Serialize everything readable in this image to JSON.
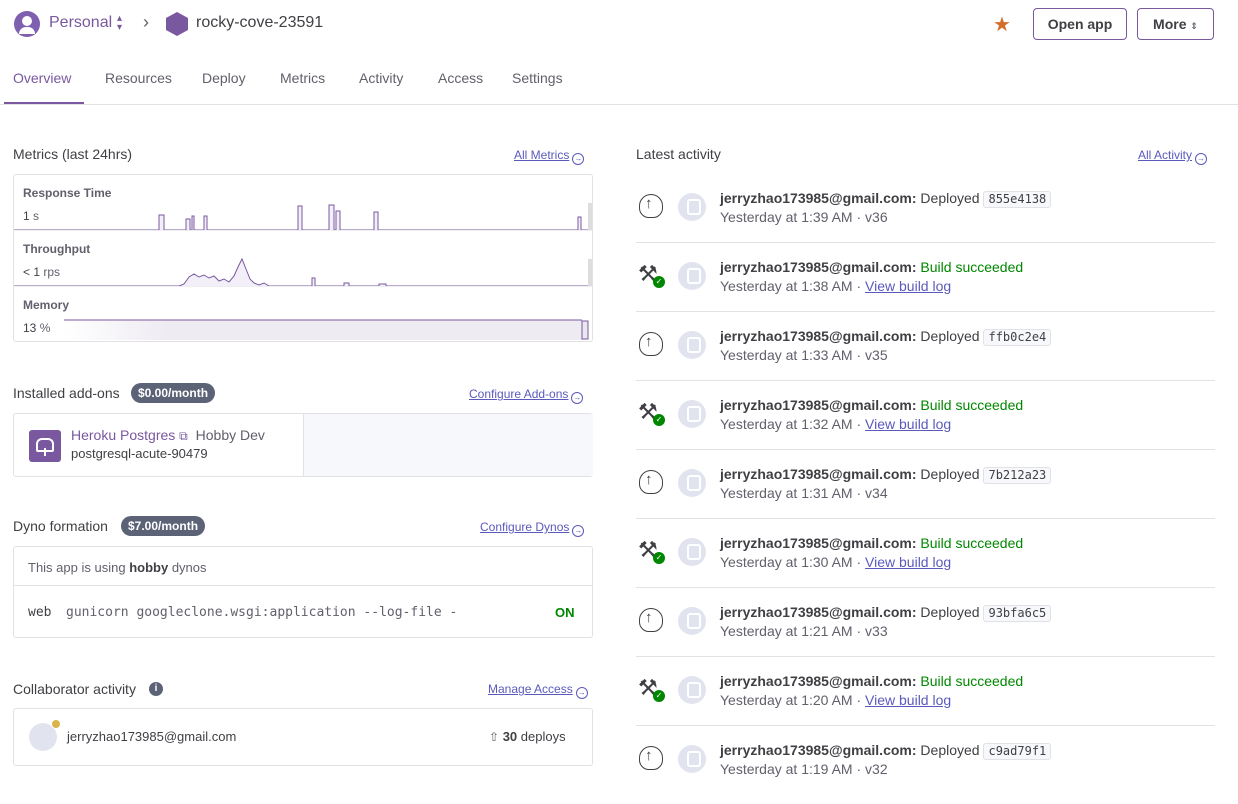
{
  "header": {
    "team": "Personal",
    "app": "rocky-cove-23591",
    "open_app": "Open app",
    "more": "More"
  },
  "tabs": [
    {
      "label": "Overview",
      "active": true
    },
    {
      "label": "Resources"
    },
    {
      "label": "Deploy"
    },
    {
      "label": "Metrics"
    },
    {
      "label": "Activity"
    },
    {
      "label": "Access"
    },
    {
      "label": "Settings"
    }
  ],
  "metrics": {
    "title": "Metrics (last 24hrs)",
    "link": "All Metrics",
    "response_time": {
      "label": "Response Time",
      "value": "1",
      "unit": "s"
    },
    "throughput": {
      "label": "Throughput",
      "value": "< 1",
      "unit": "rps"
    },
    "memory": {
      "label": "Memory",
      "value": "13",
      "unit": "%"
    }
  },
  "addons": {
    "title": "Installed add-ons",
    "price": "$0.00/month",
    "link": "Configure Add-ons",
    "items": [
      {
        "name": "Heroku Postgres",
        "plan": "Hobby Dev",
        "resource": "postgresql-acute-90479"
      }
    ]
  },
  "dynos": {
    "title": "Dyno formation",
    "price": "$7.00/month",
    "link": "Configure Dynos",
    "note_prefix": "This app is using",
    "note_type": "hobby",
    "note_suffix": "dynos",
    "process": {
      "type": "web",
      "command": "gunicorn googleclone.wsgi:application --log-file -",
      "state": "ON"
    }
  },
  "collaborators": {
    "title": "Collaborator activity",
    "link": "Manage Access",
    "items": [
      {
        "email": "jerryzhao173985@gmail.com",
        "deploys": "30",
        "deploys_label": "deploys"
      }
    ]
  },
  "activity": {
    "title": "Latest activity",
    "link": "All Activity",
    "items": [
      {
        "kind": "deploy",
        "user": "jerryzhao173985@gmail.com:",
        "action": "Deployed",
        "sha": "855e4138",
        "time": "Yesterday at 1:39 AM",
        "version": "v36"
      },
      {
        "kind": "build",
        "user": "jerryzhao173985@gmail.com:",
        "action": "Build succeeded",
        "time": "Yesterday at 1:38 AM",
        "log": "View build log"
      },
      {
        "kind": "deploy",
        "user": "jerryzhao173985@gmail.com:",
        "action": "Deployed",
        "sha": "ffb0c2e4",
        "time": "Yesterday at 1:33 AM",
        "version": "v35"
      },
      {
        "kind": "build",
        "user": "jerryzhao173985@gmail.com:",
        "action": "Build succeeded",
        "time": "Yesterday at 1:32 AM",
        "log": "View build log"
      },
      {
        "kind": "deploy",
        "user": "jerryzhao173985@gmail.com:",
        "action": "Deployed",
        "sha": "7b212a23",
        "time": "Yesterday at 1:31 AM",
        "version": "v34"
      },
      {
        "kind": "build",
        "user": "jerryzhao173985@gmail.com:",
        "action": "Build succeeded",
        "time": "Yesterday at 1:30 AM",
        "log": "View build log"
      },
      {
        "kind": "deploy",
        "user": "jerryzhao173985@gmail.com:",
        "action": "Deployed",
        "sha": "93bfa6c5",
        "time": "Yesterday at 1:21 AM",
        "version": "v33"
      },
      {
        "kind": "build",
        "user": "jerryzhao173985@gmail.com:",
        "action": "Build succeeded",
        "time": "Yesterday at 1:20 AM",
        "log": "View build log"
      },
      {
        "kind": "deploy",
        "user": "jerryzhao173985@gmail.com:",
        "action": "Deployed",
        "sha": "c9ad79f1",
        "time": "Yesterday at 1:19 AM",
        "version": "v32"
      }
    ]
  },
  "colors": {
    "brand": "#79589f",
    "link": "#5b59bc",
    "success": "#008700",
    "star": "#d36d29"
  },
  "icons": [
    "user-avatar-icon",
    "chevron-updown-icon",
    "chevron-right-icon",
    "app-hexagon-icon",
    "star-icon",
    "arrow-circle-right-icon",
    "postgres-icon",
    "external-link-icon",
    "info-icon",
    "deploy-icon",
    "hammer-icon",
    "check-icon"
  ]
}
